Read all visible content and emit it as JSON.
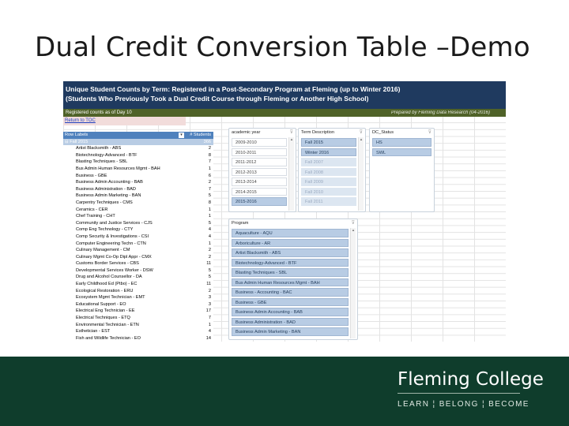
{
  "slide_title": "Dual Credit Conversion Table –Demo",
  "report": {
    "title_line1": "Unique Student Counts by Term: Registered in a Post-Secondary Program at Fleming (up to Winter 2016)",
    "title_line2": "(Students Who Previously Took a Dual Credit Course through Fleming or Another High School)",
    "subtitle": "Registered counts as of Day 10",
    "prepared_by": "Prepared by Fleming Data Research (04-2016)",
    "toc_link": "Return to TOC"
  },
  "pivot": {
    "col_label": "Row Labels",
    "col_count": "# Students",
    "group": {
      "label": "⊟ Fall 2015",
      "count": "366"
    },
    "rows": [
      {
        "label": "Artist Blacksmith - ABS",
        "count": "2"
      },
      {
        "label": "Biotechnology-Advanced - BTF",
        "count": "8"
      },
      {
        "label": "Blasting Techniques - SBL",
        "count": "7"
      },
      {
        "label": "Bus Admin Human Resources Mgmt - BAH",
        "count": "1"
      },
      {
        "label": "Business - GBE",
        "count": "6"
      },
      {
        "label": "Business Admin Accounting - BAB",
        "count": "2"
      },
      {
        "label": "Business Administration - BAD",
        "count": "7"
      },
      {
        "label": "Business Admin Marketing - BAN",
        "count": "5"
      },
      {
        "label": "Carpentry Techniques - CMS",
        "count": "8"
      },
      {
        "label": "Ceramics - CER",
        "count": "1"
      },
      {
        "label": "Chef Training - CHT",
        "count": "1"
      },
      {
        "label": "Community and Justice Services - CJS",
        "count": "5"
      },
      {
        "label": "Comp Eng Technology - CTY",
        "count": "4"
      },
      {
        "label": "Comp Security & Investigations - CSI",
        "count": "4"
      },
      {
        "label": "Computer Engineering Techn - CTN",
        "count": "1"
      },
      {
        "label": "Culinary Management - CM",
        "count": "2"
      },
      {
        "label": "Culinary Mgmt Co-Op Dipl Appr - CMX",
        "count": "2"
      },
      {
        "label": "Customs Border Services - CBS",
        "count": "11"
      },
      {
        "label": "Developmental Services Worker - DSW",
        "count": "5"
      },
      {
        "label": "Drug and Alcohol Counsellor - DA",
        "count": "5"
      },
      {
        "label": "Early Childhood Ed (Ptbo) - EC",
        "count": "11"
      },
      {
        "label": "Ecological Restoration - ERU",
        "count": "2"
      },
      {
        "label": "Ecosystem Mgmt Technician - EMT",
        "count": "3"
      },
      {
        "label": "Educational Support - EO",
        "count": "3"
      },
      {
        "label": "Electrical Eng Technician - EE",
        "count": "17"
      },
      {
        "label": "Electrical Techniques - ETQ",
        "count": "7"
      },
      {
        "label": "Environmental Technician - ETN",
        "count": "1"
      },
      {
        "label": "Esthetician - EST",
        "count": "4"
      },
      {
        "label": "Fish and Wildlife Technician - EO",
        "count": "14"
      }
    ]
  },
  "slicers": {
    "academic_year": {
      "title": "academic year",
      "items": [
        {
          "label": "2009-2010",
          "state": "normal"
        },
        {
          "label": "2010-2011",
          "state": "normal"
        },
        {
          "label": "2011-2012",
          "state": "normal"
        },
        {
          "label": "2012-2013",
          "state": "normal"
        },
        {
          "label": "2013-2014",
          "state": "normal"
        },
        {
          "label": "2014-2015",
          "state": "normal"
        },
        {
          "label": "2015-2016",
          "state": "sel"
        }
      ]
    },
    "term": {
      "title": "Term Description",
      "items": [
        {
          "label": "Fall 2015",
          "state": "sel"
        },
        {
          "label": "Winter 2016",
          "state": "sel"
        },
        {
          "label": "Fall 2007",
          "state": "dim"
        },
        {
          "label": "Fall 2008",
          "state": "dim"
        },
        {
          "label": "Fall 2009",
          "state": "dim"
        },
        {
          "label": "Fall 2010",
          "state": "dim"
        },
        {
          "label": "Fall 2011",
          "state": "dim"
        }
      ]
    },
    "dc_status": {
      "title": "DC_Status",
      "items": [
        {
          "label": "HS",
          "state": "sel"
        },
        {
          "label": "SWL",
          "state": "sel"
        }
      ]
    },
    "program": {
      "title": "Program",
      "items": [
        {
          "label": "Aquaculture - AQU",
          "state": "sel"
        },
        {
          "label": "Arboriculture - AR",
          "state": "sel"
        },
        {
          "label": "Artist Blacksmith - ABS",
          "state": "sel"
        },
        {
          "label": "Biotechnology-Advanced - BTF",
          "state": "sel"
        },
        {
          "label": "Blasting Techniques - SBL",
          "state": "sel"
        },
        {
          "label": "Bus Admin Human Resources Mgmt - BAH",
          "state": "sel"
        },
        {
          "label": "Business - Accounting - BAC",
          "state": "sel"
        },
        {
          "label": "Business - GBE",
          "state": "sel"
        },
        {
          "label": "Business Admin Accounting - BAB",
          "state": "sel"
        },
        {
          "label": "Business Administration - BAD",
          "state": "sel"
        },
        {
          "label": "Business Admin Marketing - BAN",
          "state": "sel"
        }
      ]
    }
  },
  "footer": {
    "logo": "Fleming College",
    "tagline": "LEARN  ¦  BELONG  ¦  BECOME"
  }
}
